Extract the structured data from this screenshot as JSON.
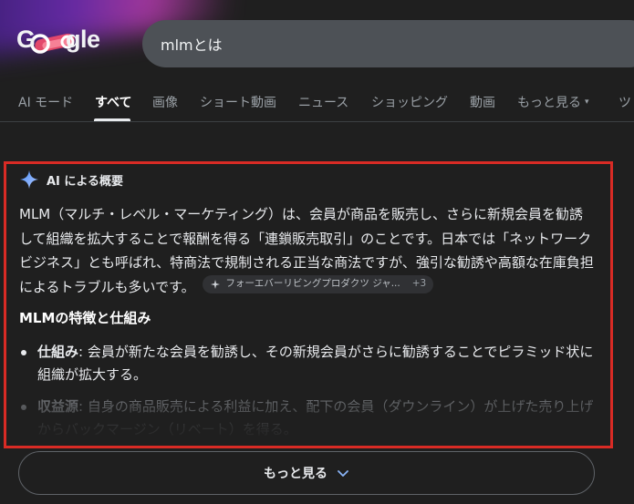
{
  "logo": {
    "text": "Google"
  },
  "search": {
    "value": "mlmとは"
  },
  "tabs": [
    {
      "label": "AI モード"
    },
    {
      "label": "すべて"
    },
    {
      "label": "画像"
    },
    {
      "label": "ショート動画"
    },
    {
      "label": "ニュース"
    },
    {
      "label": "ショッピング"
    },
    {
      "label": "動画"
    },
    {
      "label": "もっと見る"
    },
    {
      "label": "ツ"
    }
  ],
  "ai_overview": {
    "title": "AI による概要",
    "intro": "MLM（マルチ・レベル・マーケティング）は、会員が商品を販売し、さらに新規会員を勧誘して組織を拡大することで報酬を得る「連鎖販売取引」のことです。日本では「ネットワークビジネス」とも呼ばれ、特商法で規制される正当な商法ですが、強引な勧誘や高額な在庫負担によるトラブルも多いです。",
    "source_chip": {
      "label": "フォーエバーリビングプロダクツ ジャ...",
      "count": "+3"
    },
    "subheading": "MLMの特徴と仕組み",
    "bullets": [
      {
        "term": "仕組み",
        "text": ": 会員が新たな会員を勧誘し、その新規会員がさらに勧誘することでピラミッド状に組織が拡大する。"
      },
      {
        "term": "収益源",
        "text": ": 自身の商品販売による利益に加え、配下の会員（ダウンライン）が上げた売り上げからバックマージン（リベート）を得る。"
      }
    ]
  },
  "more_button": {
    "label": "もっと見る"
  },
  "colors": {
    "highlight_border": "#d92b25",
    "background": "#1f1f1f",
    "search_bg": "#4d5156"
  }
}
